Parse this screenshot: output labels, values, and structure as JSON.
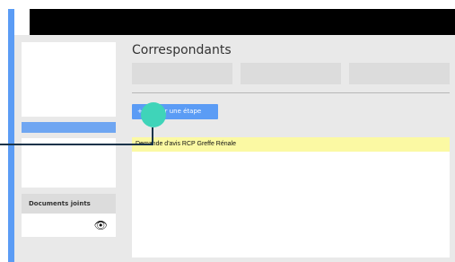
{
  "main": {
    "title": "Correspondants",
    "add_step_button": "+ Ajouter une étape",
    "step_row": "Demande d'avis RCP Greffe Rénale"
  },
  "sidebar": {
    "documents_header": "Documents joints",
    "eye_icon": "eye-icon"
  },
  "colors": {
    "accent": "#5b9cf5",
    "highlight_row": "#fbf9a3",
    "cursor": "#3fd4b9"
  }
}
